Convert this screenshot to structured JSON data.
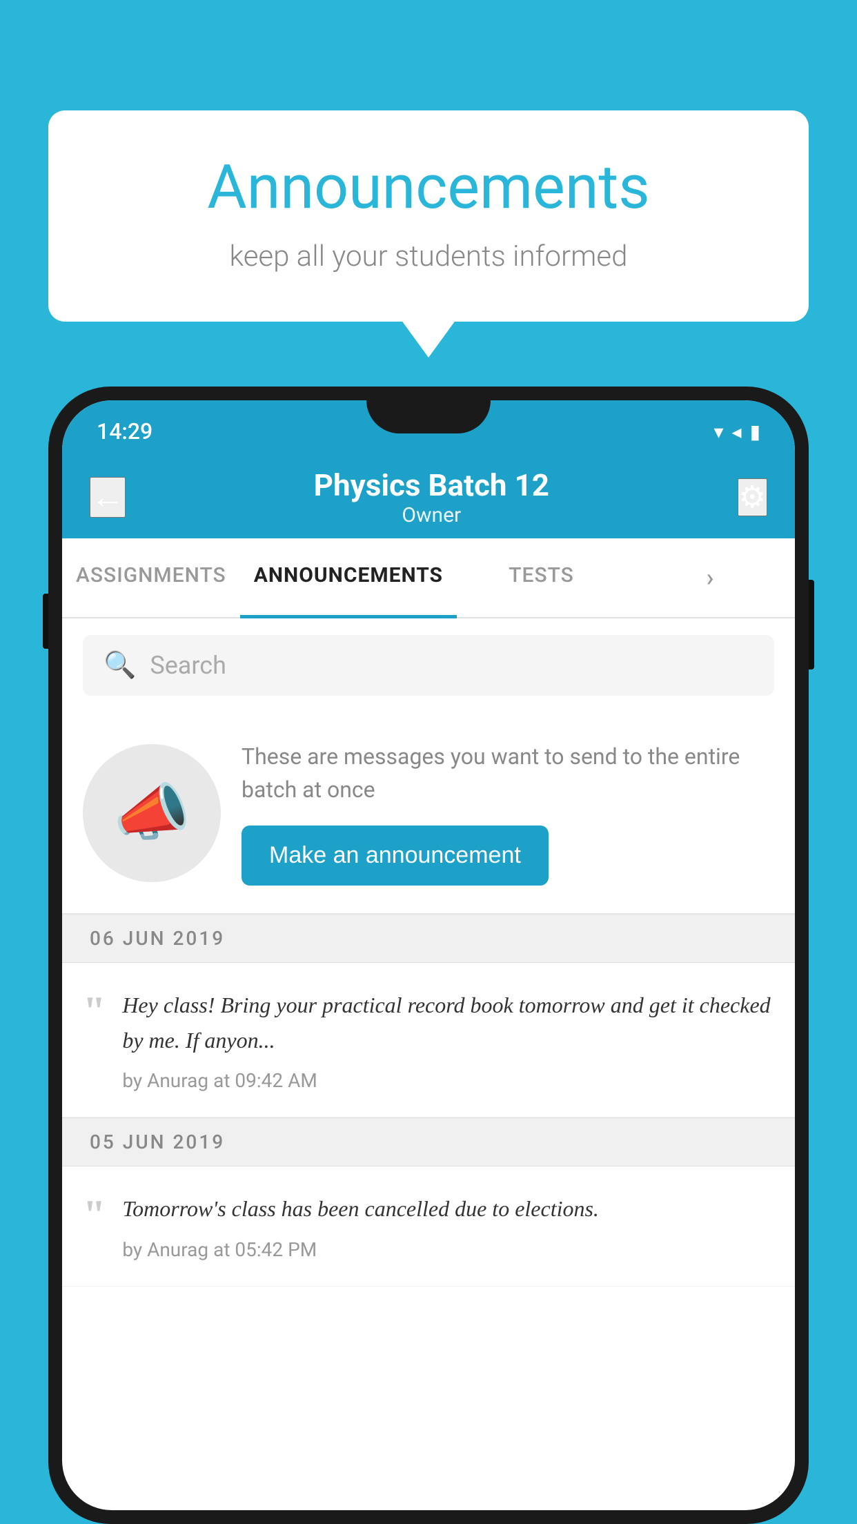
{
  "bubble": {
    "title": "Announcements",
    "subtitle": "keep all your students informed"
  },
  "status_bar": {
    "time": "14:29",
    "wifi_icon": "▼",
    "signal_icon": "▲",
    "battery_icon": "▮"
  },
  "header": {
    "title": "Physics Batch 12",
    "subtitle": "Owner",
    "back_label": "←",
    "settings_label": "⚙"
  },
  "tabs": [
    {
      "label": "ASSIGNMENTS",
      "active": false
    },
    {
      "label": "ANNOUNCEMENTS",
      "active": true
    },
    {
      "label": "TESTS",
      "active": false
    },
    {
      "label": "MORE",
      "active": false
    }
  ],
  "search": {
    "placeholder": "Search"
  },
  "promo": {
    "description": "These are messages you want to send to the entire batch at once",
    "button_label": "Make an announcement"
  },
  "announcements": [
    {
      "date": "06  JUN  2019",
      "text": "Hey class! Bring your practical record book tomorrow and get it checked by me. If anyon...",
      "meta": "by Anurag at 09:42 AM"
    },
    {
      "date": "05  JUN  2019",
      "text": "Tomorrow's class has been cancelled due to elections.",
      "meta": "by Anurag at 05:42 PM"
    }
  ],
  "colors": {
    "primary": "#1da1c8",
    "background": "#29b6d8"
  }
}
